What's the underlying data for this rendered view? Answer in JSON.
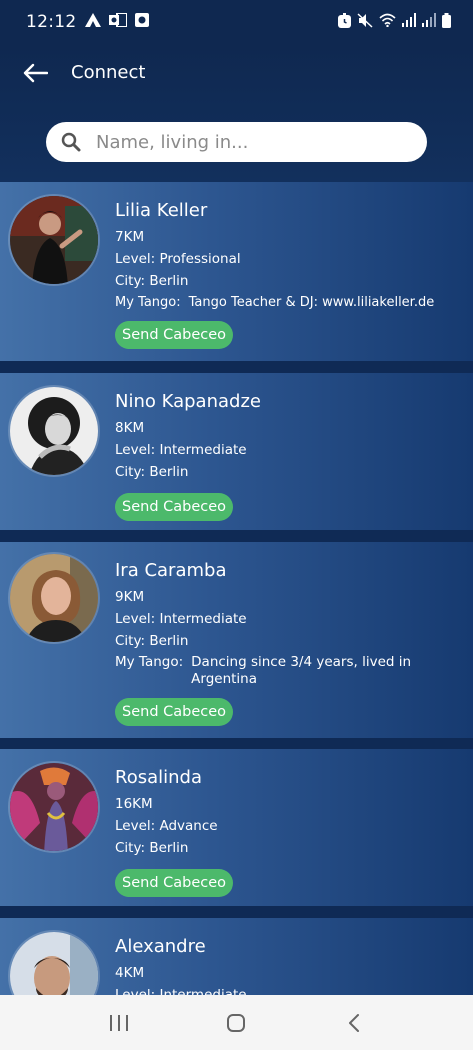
{
  "status_bar": {
    "time": "12:12",
    "left_icons": [
      "navigation-icon",
      "outlook-icon",
      "app-icon"
    ],
    "right_icons": [
      "alarm-icon",
      "mute-icon",
      "wifi-icon",
      "signal-icon",
      "signal-icon",
      "battery-icon"
    ]
  },
  "header": {
    "back_icon": "arrow-left-icon",
    "title": "Connect"
  },
  "search": {
    "icon": "search-icon",
    "placeholder": "Name, living in..."
  },
  "profiles": [
    {
      "name": "Lilia Keller",
      "distance": "7KM",
      "level": "Level: Professional",
      "city": "City: Berlin",
      "tango_label": "My Tango:",
      "tango_text": "Tango Teacher & DJ: www.liliakeller.de",
      "button": "Send Cabeceo"
    },
    {
      "name": "Nino Kapanadze",
      "distance": "8KM",
      "level": "Level: Intermediate",
      "city": "City: Berlin",
      "button": "Send Cabeceo"
    },
    {
      "name": "Ira Caramba",
      "distance": "9KM",
      "level": "Level: Intermediate",
      "city": "City: Berlin",
      "tango_label": "My Tango:",
      "tango_text": "Dancing since 3/4 years, lived in Argentina",
      "button": "Send Cabeceo"
    },
    {
      "name": "Rosalinda",
      "distance": "16KM",
      "level": "Level: Advance",
      "city": "City: Berlin",
      "button": "Send Cabeceo"
    },
    {
      "name": "Alexandre",
      "distance": "4KM",
      "level": "Level: Intermediate"
    }
  ],
  "nav_bar": {
    "icons": [
      "recent-apps-icon",
      "home-icon",
      "back-icon"
    ]
  },
  "colors": {
    "background": "#0f2a55",
    "card_left": "#4471a8",
    "card_right": "#163a70",
    "button": "#4cb96b"
  }
}
